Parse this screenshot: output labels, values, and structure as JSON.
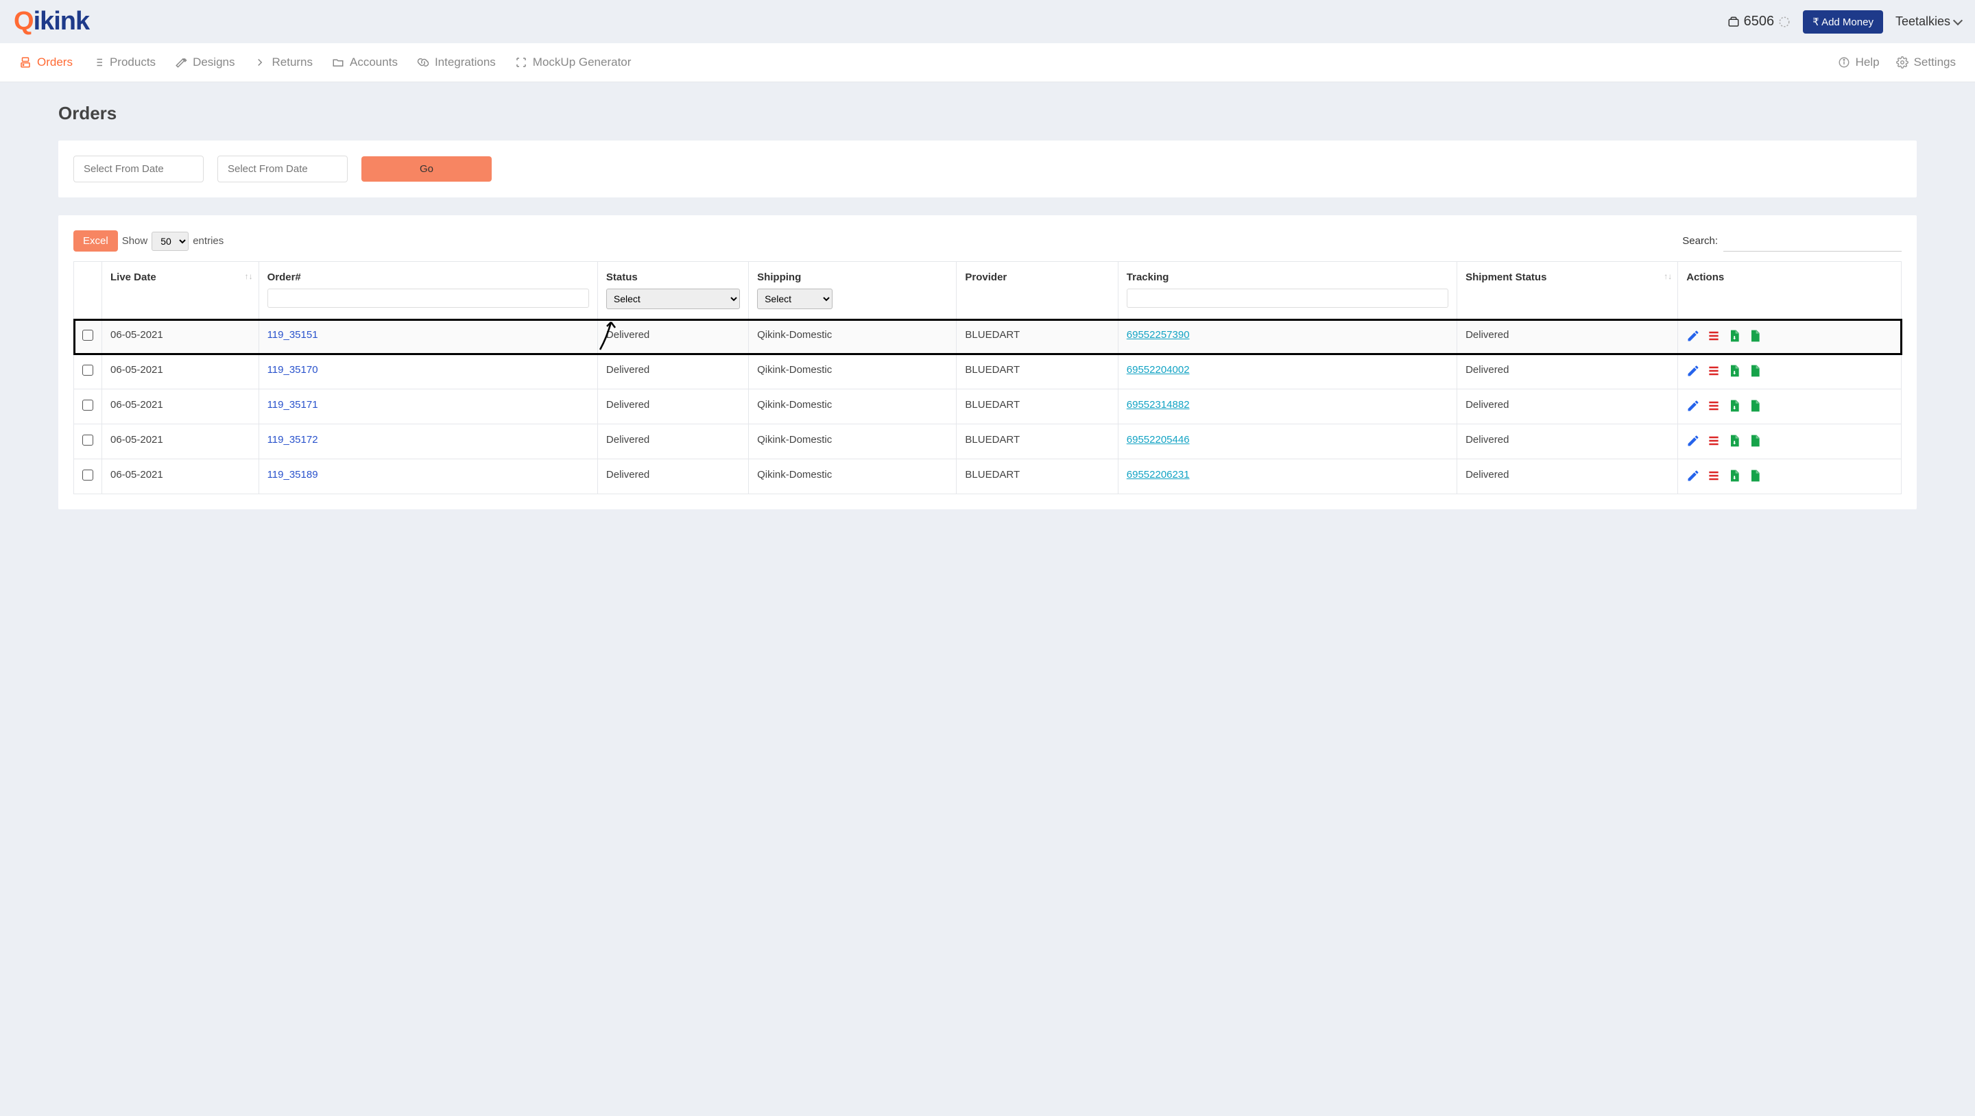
{
  "header": {
    "logo_q": "Q",
    "logo_rest": "ikink",
    "wallet_balance": "6506",
    "add_money_label": "Add Money",
    "user_name": "Teetalkies"
  },
  "nav": {
    "items": [
      {
        "label": "Orders",
        "active": true
      },
      {
        "label": "Products"
      },
      {
        "label": "Designs"
      },
      {
        "label": "Returns"
      },
      {
        "label": "Accounts"
      },
      {
        "label": "Integrations"
      },
      {
        "label": "MockUp Generator"
      }
    ],
    "help_label": "Help",
    "settings_label": "Settings"
  },
  "page": {
    "title": "Orders",
    "from_date_placeholder": "Select From Date",
    "to_date_placeholder": "Select From Date",
    "go_label": "Go"
  },
  "table_controls": {
    "excel_label": "Excel",
    "show_label": "Show",
    "page_size": "50",
    "entries_label": "entries",
    "search_label": "Search:"
  },
  "columns": {
    "live_date": "Live Date",
    "order": "Order#",
    "status": "Status",
    "shipping": "Shipping",
    "provider": "Provider",
    "tracking": "Tracking",
    "shipment_status": "Shipment Status",
    "actions": "Actions",
    "select_placeholder": "Select"
  },
  "rows": [
    {
      "live_date": "06-05-2021",
      "order": "119_35151",
      "status": "Delivered",
      "shipping": "Qikink-Domestic",
      "provider": "BLUEDART",
      "tracking": "69552257390",
      "shipment_status": "Delivered",
      "highlight": true
    },
    {
      "live_date": "06-05-2021",
      "order": "119_35170",
      "status": "Delivered",
      "shipping": "Qikink-Domestic",
      "provider": "BLUEDART",
      "tracking": "69552204002",
      "shipment_status": "Delivered"
    },
    {
      "live_date": "06-05-2021",
      "order": "119_35171",
      "status": "Delivered",
      "shipping": "Qikink-Domestic",
      "provider": "BLUEDART",
      "tracking": "69552314882",
      "shipment_status": "Delivered"
    },
    {
      "live_date": "06-05-2021",
      "order": "119_35172",
      "status": "Delivered",
      "shipping": "Qikink-Domestic",
      "provider": "BLUEDART",
      "tracking": "69552205446",
      "shipment_status": "Delivered"
    },
    {
      "live_date": "06-05-2021",
      "order": "119_35189",
      "status": "Delivered",
      "shipping": "Qikink-Domestic",
      "provider": "BLUEDART",
      "tracking": "69552206231",
      "shipment_status": "Delivered"
    }
  ]
}
